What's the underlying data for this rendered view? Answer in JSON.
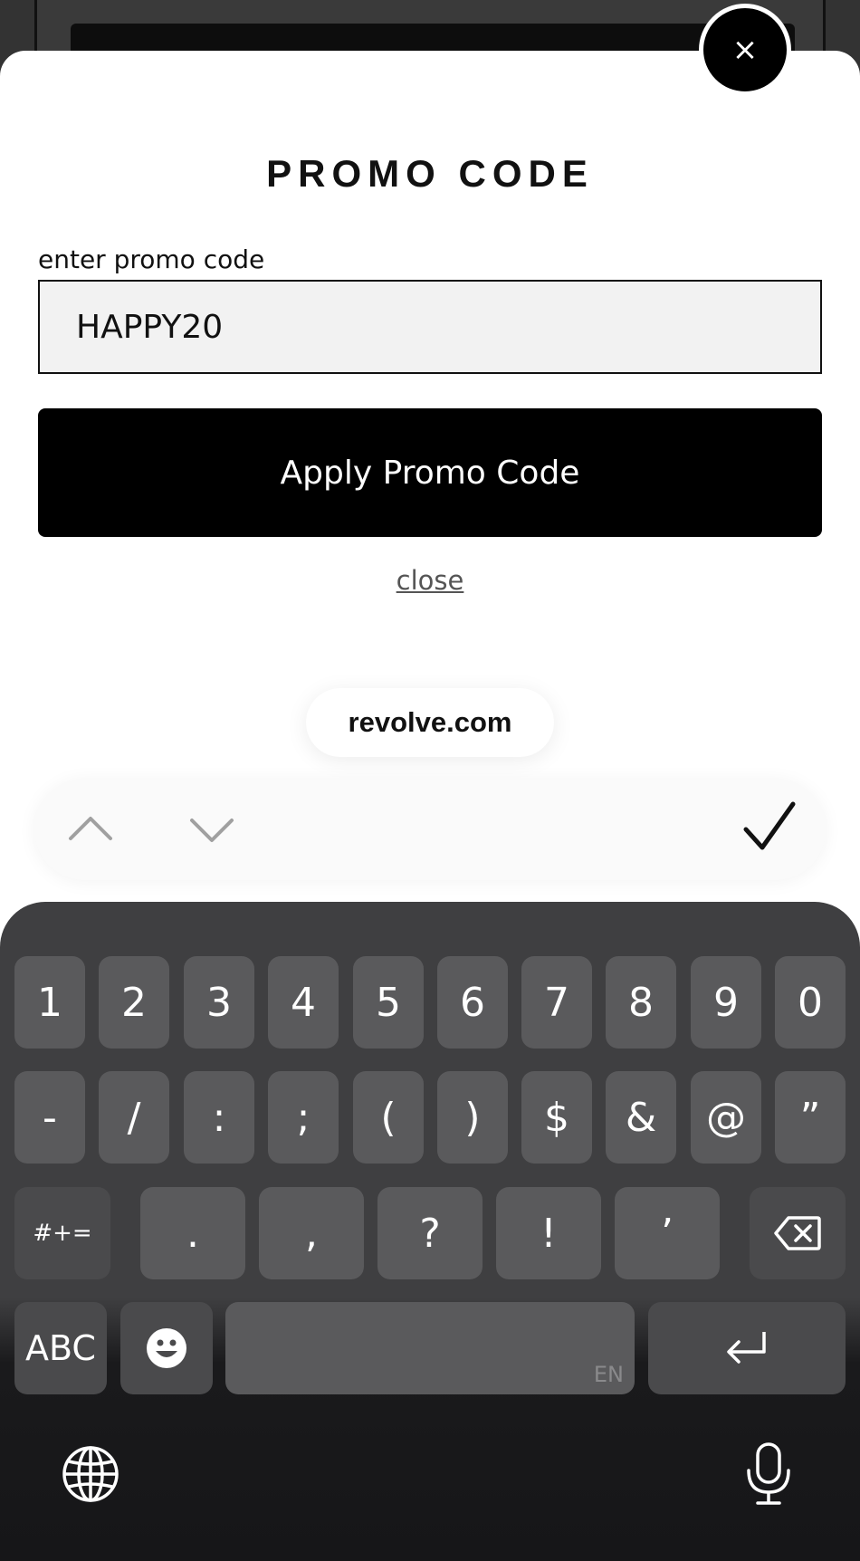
{
  "dialog": {
    "close_symbol": "×",
    "title": "PROMO CODE",
    "field_label": "enter promo code",
    "promo_value": "HAPPY20",
    "apply_label": "Apply Promo Code",
    "close_link": "close"
  },
  "browser": {
    "domain": "revolve.com"
  },
  "toolbar": {
    "prev_icon": "chevron-up-icon",
    "next_icon": "chevron-down-icon",
    "done_icon": "checkmark-icon"
  },
  "keyboard": {
    "row1": [
      "1",
      "2",
      "3",
      "4",
      "5",
      "6",
      "7",
      "8",
      "9",
      "0"
    ],
    "row2": [
      "-",
      "/",
      ":",
      ";",
      "(",
      ")",
      "$",
      "&",
      "@",
      "”"
    ],
    "row3": [
      "#+=",
      ".",
      ",",
      "?",
      "!",
      "’"
    ],
    "abc": "ABC",
    "space_lang": "EN",
    "icons": [
      "backspace-icon",
      "emoji-icon",
      "return-icon",
      "globe-icon",
      "microphone-icon"
    ]
  },
  "colors": {
    "primary": "#000000",
    "sheet": "#ffffff",
    "input_bg": "#f2f2f2",
    "keyboard_bg": "#3f3f41",
    "key": "#5a5a5c"
  }
}
